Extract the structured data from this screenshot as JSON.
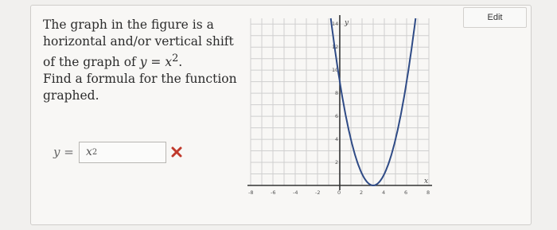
{
  "question": {
    "line1": "The graph in the figure is a",
    "line2": "horizontal and/or vertical shift",
    "line3_prefix": "of the graph of ",
    "line3_math": "y = x",
    "line3_exp": "2",
    "line3_suffix": ".",
    "line4": "Find a formula for the function",
    "line5": "graphed."
  },
  "answer": {
    "lhs": "y =",
    "value_base": "x",
    "value_exp": "2",
    "status": "incorrect",
    "mark_color": "#c0392b"
  },
  "edit_button": {
    "label": "Edit"
  },
  "graph": {
    "y_axis_label": "y",
    "x_axis_label": "x",
    "x_ticks": [
      "-8",
      "-6",
      "-4",
      "-2",
      "0",
      "2",
      "4",
      "6",
      "8"
    ],
    "y_ticks": [
      "2",
      "4",
      "6",
      "8",
      "10",
      "12",
      "14"
    ],
    "x_range": [
      -8,
      8
    ],
    "y_range": [
      0,
      14.5
    ],
    "curve": {
      "vertex_x": 3,
      "vertex_y": 0
    },
    "curve_color": "#2f4b86"
  }
}
